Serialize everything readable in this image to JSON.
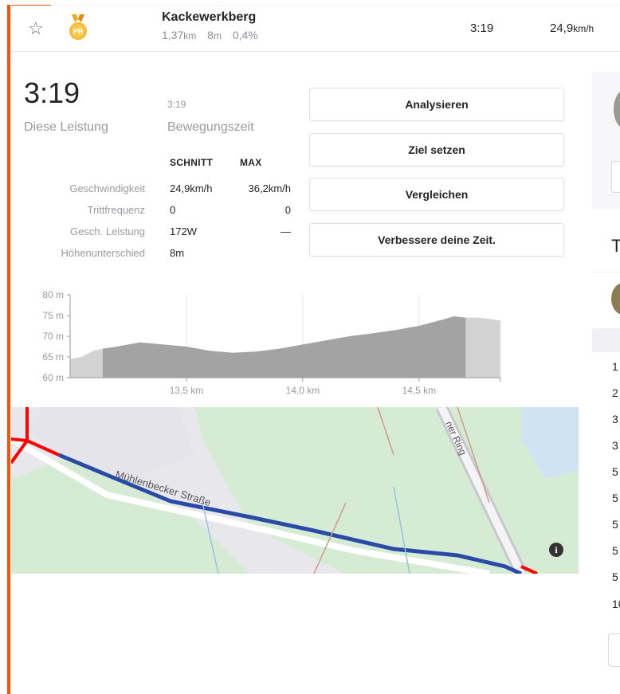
{
  "segment": {
    "name": "Kackewerkberg",
    "distance_value": "1,37",
    "distance_unit": "km",
    "elevation_value": "8",
    "elevation_unit": "m",
    "grade": "0,4%",
    "time": "3:19",
    "speed_value": "24,9",
    "speed_unit": "km/h",
    "badge": "PR",
    "star_icon": "star-outline-icon",
    "medal_icon": "pr-medal-icon"
  },
  "effort": {
    "time": "3:19",
    "time_label": "Diese Leistung",
    "moving_time": "3:19",
    "moving_time_label": "Bewegungszeit"
  },
  "stats": {
    "headers": [
      "SCHNITT",
      "MAX"
    ],
    "rows": [
      {
        "label": "Geschwindigkeit",
        "avg": "24,9km/h",
        "max": "36,2km/h"
      },
      {
        "label": "Trittfrequenz",
        "avg": "0",
        "max": "0"
      },
      {
        "label": "Gesch. Leistung",
        "avg": "172W",
        "max": "—"
      },
      {
        "label": "Höhenunterschied",
        "avg": "8m",
        "max": ""
      }
    ]
  },
  "actions": {
    "analyze": "Analysieren",
    "set_goal": "Ziel setzen",
    "compare": "Vergleichen",
    "improve": "Verbessere deine Zeit."
  },
  "chart_data": {
    "type": "area",
    "xlabel": "",
    "ylabel": "",
    "x_ticks": [
      "13,5 km",
      "14,0 km",
      "14,5 km"
    ],
    "y_ticks": [
      "80 m",
      "75 m",
      "70 m",
      "65 m",
      "60 m"
    ],
    "ylim": [
      60,
      80
    ],
    "xlim": [
      13.0,
      14.85
    ],
    "segment_range_km": [
      13.14,
      14.7
    ],
    "x": [
      13.0,
      13.05,
      13.1,
      13.14,
      13.2,
      13.3,
      13.4,
      13.5,
      13.6,
      13.7,
      13.8,
      13.9,
      14.0,
      14.1,
      14.2,
      14.3,
      14.4,
      14.5,
      14.6,
      14.65,
      14.7,
      14.75,
      14.8,
      14.85
    ],
    "y": [
      64.5,
      65.0,
      66.5,
      67.0,
      67.5,
      68.5,
      68.0,
      67.5,
      66.5,
      66.0,
      66.3,
      67.0,
      68.0,
      69.0,
      70.0,
      70.7,
      71.5,
      72.5,
      74.0,
      74.8,
      74.5,
      74.5,
      74.2,
      73.8
    ],
    "grid": true,
    "colors": {
      "segment": "#a3a3a3",
      "context": "#d3d3d3"
    }
  },
  "map": {
    "street_label": "Mühlenbecker Straße",
    "ring_label": "ner Ring",
    "info_icon": "info-icon",
    "route_color": "#2a4aa8",
    "context_route_color": "#ff0000"
  },
  "sidebar": {
    "heading_initial": "T",
    "ranks": [
      "1",
      "2",
      "3",
      "3",
      "5",
      "5",
      "5",
      "5",
      "5",
      "10"
    ]
  }
}
